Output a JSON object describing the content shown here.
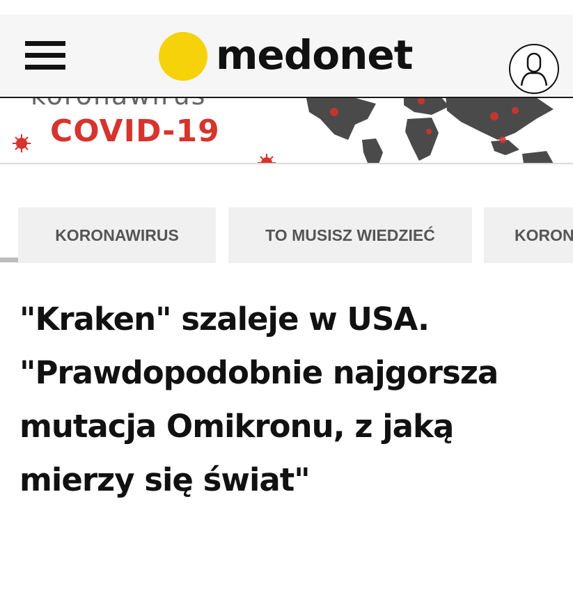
{
  "header": {
    "logo_text": "medonet",
    "brand_color": "#f5d20a",
    "menu_icon": "hamburger-menu-icon",
    "user_icon": "user-profile-icon"
  },
  "banner": {
    "top_text": "koronawirus",
    "title": "COVID-19",
    "accent_color": "#d6342c"
  },
  "tabs": [
    {
      "label": "KORONAWIRUS"
    },
    {
      "label": "TO MUSISZ WIEDZIEĆ"
    },
    {
      "label": "KORONAWIRUS"
    }
  ],
  "article": {
    "headline": "\"Kraken\" szaleje w USA. \"Prawdopodobnie najgorsza mutacja Omikronu, z jaką mierzy się świat\""
  }
}
